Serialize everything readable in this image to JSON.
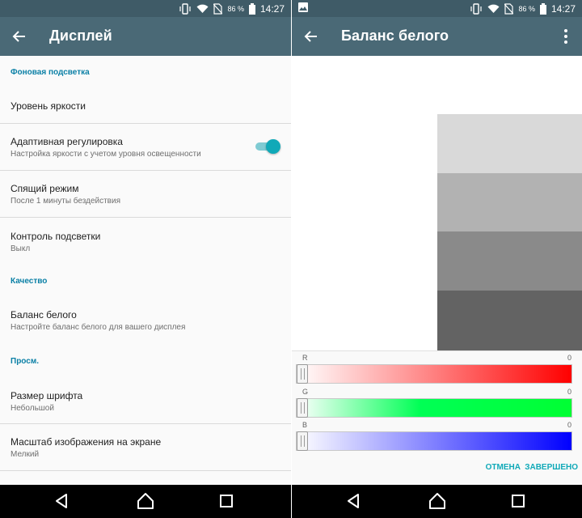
{
  "status": {
    "battery": "86 %",
    "time": "14:27"
  },
  "display": {
    "title": "Дисплей",
    "sections": [
      {
        "header": "Фоновая подсветка"
      },
      {
        "header": "Качество"
      },
      {
        "header": "Просм."
      }
    ],
    "items": [
      {
        "title": "Уровень яркости"
      },
      {
        "title": "Адаптивная регулировка",
        "summary": "Настройка яркости с учетом уровня освещенности",
        "toggle_on": true
      },
      {
        "title": "Спящий режим",
        "summary": "После 1 минуты бездействия"
      },
      {
        "title": "Контроль подсветки",
        "summary": "Выкл"
      },
      {
        "title": "Баланс белого",
        "summary": "Настройте баланс белого для вашего дисплея"
      },
      {
        "title": "Размер шрифта",
        "summary": "Небольшой"
      },
      {
        "title": "Масштаб изображения на экране",
        "summary": "Мелкий"
      }
    ]
  },
  "white_balance": {
    "title": "Баланс белого",
    "swatches": [
      "#d9d9d9",
      "#b2b2b2",
      "#8a8a8a",
      "#636363"
    ],
    "channels": [
      {
        "label": "R",
        "value": "0"
      },
      {
        "label": "G",
        "value": "0"
      },
      {
        "label": "B",
        "value": "0"
      }
    ],
    "cancel_label": "ОТМЕНА",
    "done_label": "ЗАВЕРШЕНО"
  },
  "colors": {
    "toolbar": "#4a6976",
    "statusbar": "#3f5b67",
    "accent": "#10a9b8",
    "category": "#0b80a6"
  },
  "icons": [
    "back-arrow-icon",
    "overflow-menu-icon",
    "vibrate-icon",
    "wifi-icon",
    "no-sim-icon",
    "battery-icon",
    "image-notification-icon",
    "nav-back-icon",
    "nav-home-icon",
    "nav-recents-icon"
  ]
}
